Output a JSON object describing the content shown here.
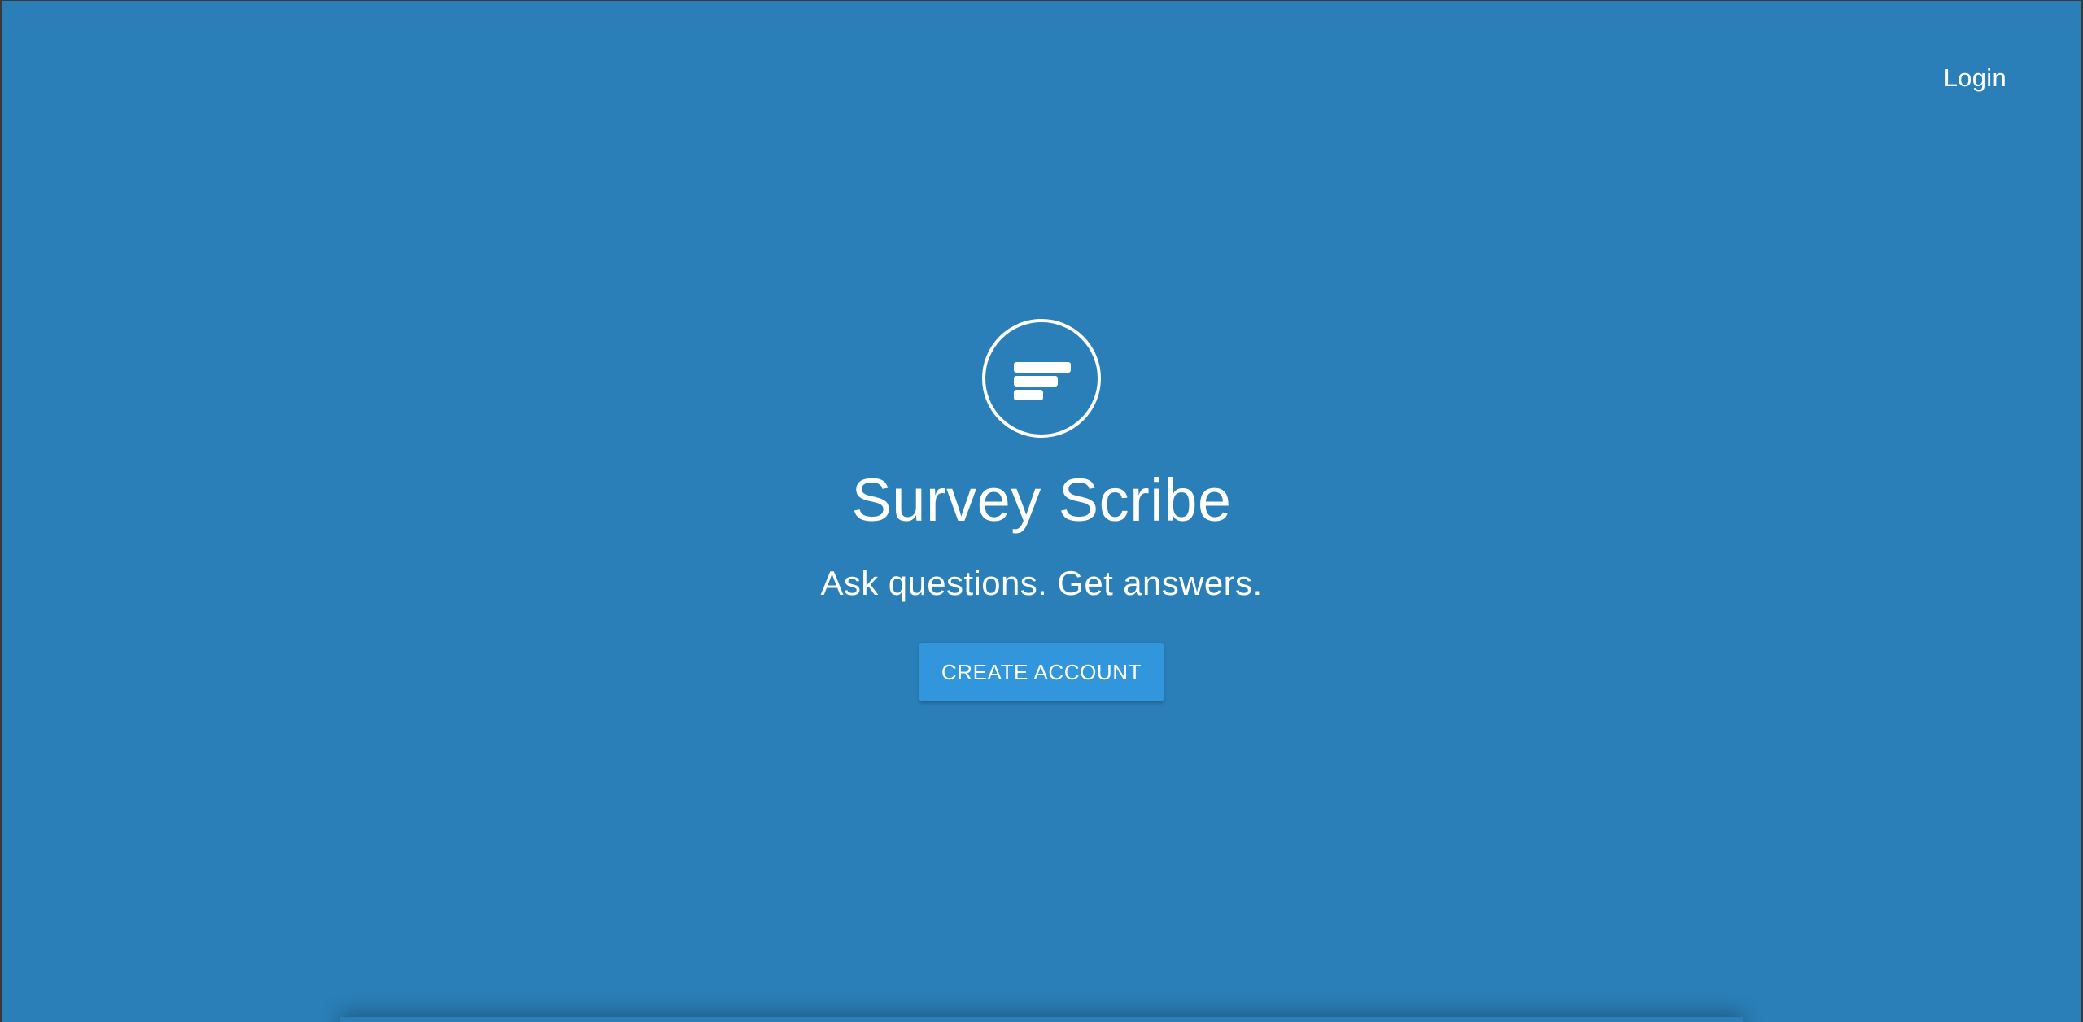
{
  "nav": {
    "login_label": "Login"
  },
  "hero": {
    "logo_icon": "survey-bars-icon",
    "title": "Survey Scribe",
    "tagline": "Ask questions. Get answers.",
    "cta_label": "CREATE ACCOUNT"
  },
  "colors": {
    "background": "#2a7fb8",
    "button": "#3196db",
    "text": "#ffffff"
  }
}
